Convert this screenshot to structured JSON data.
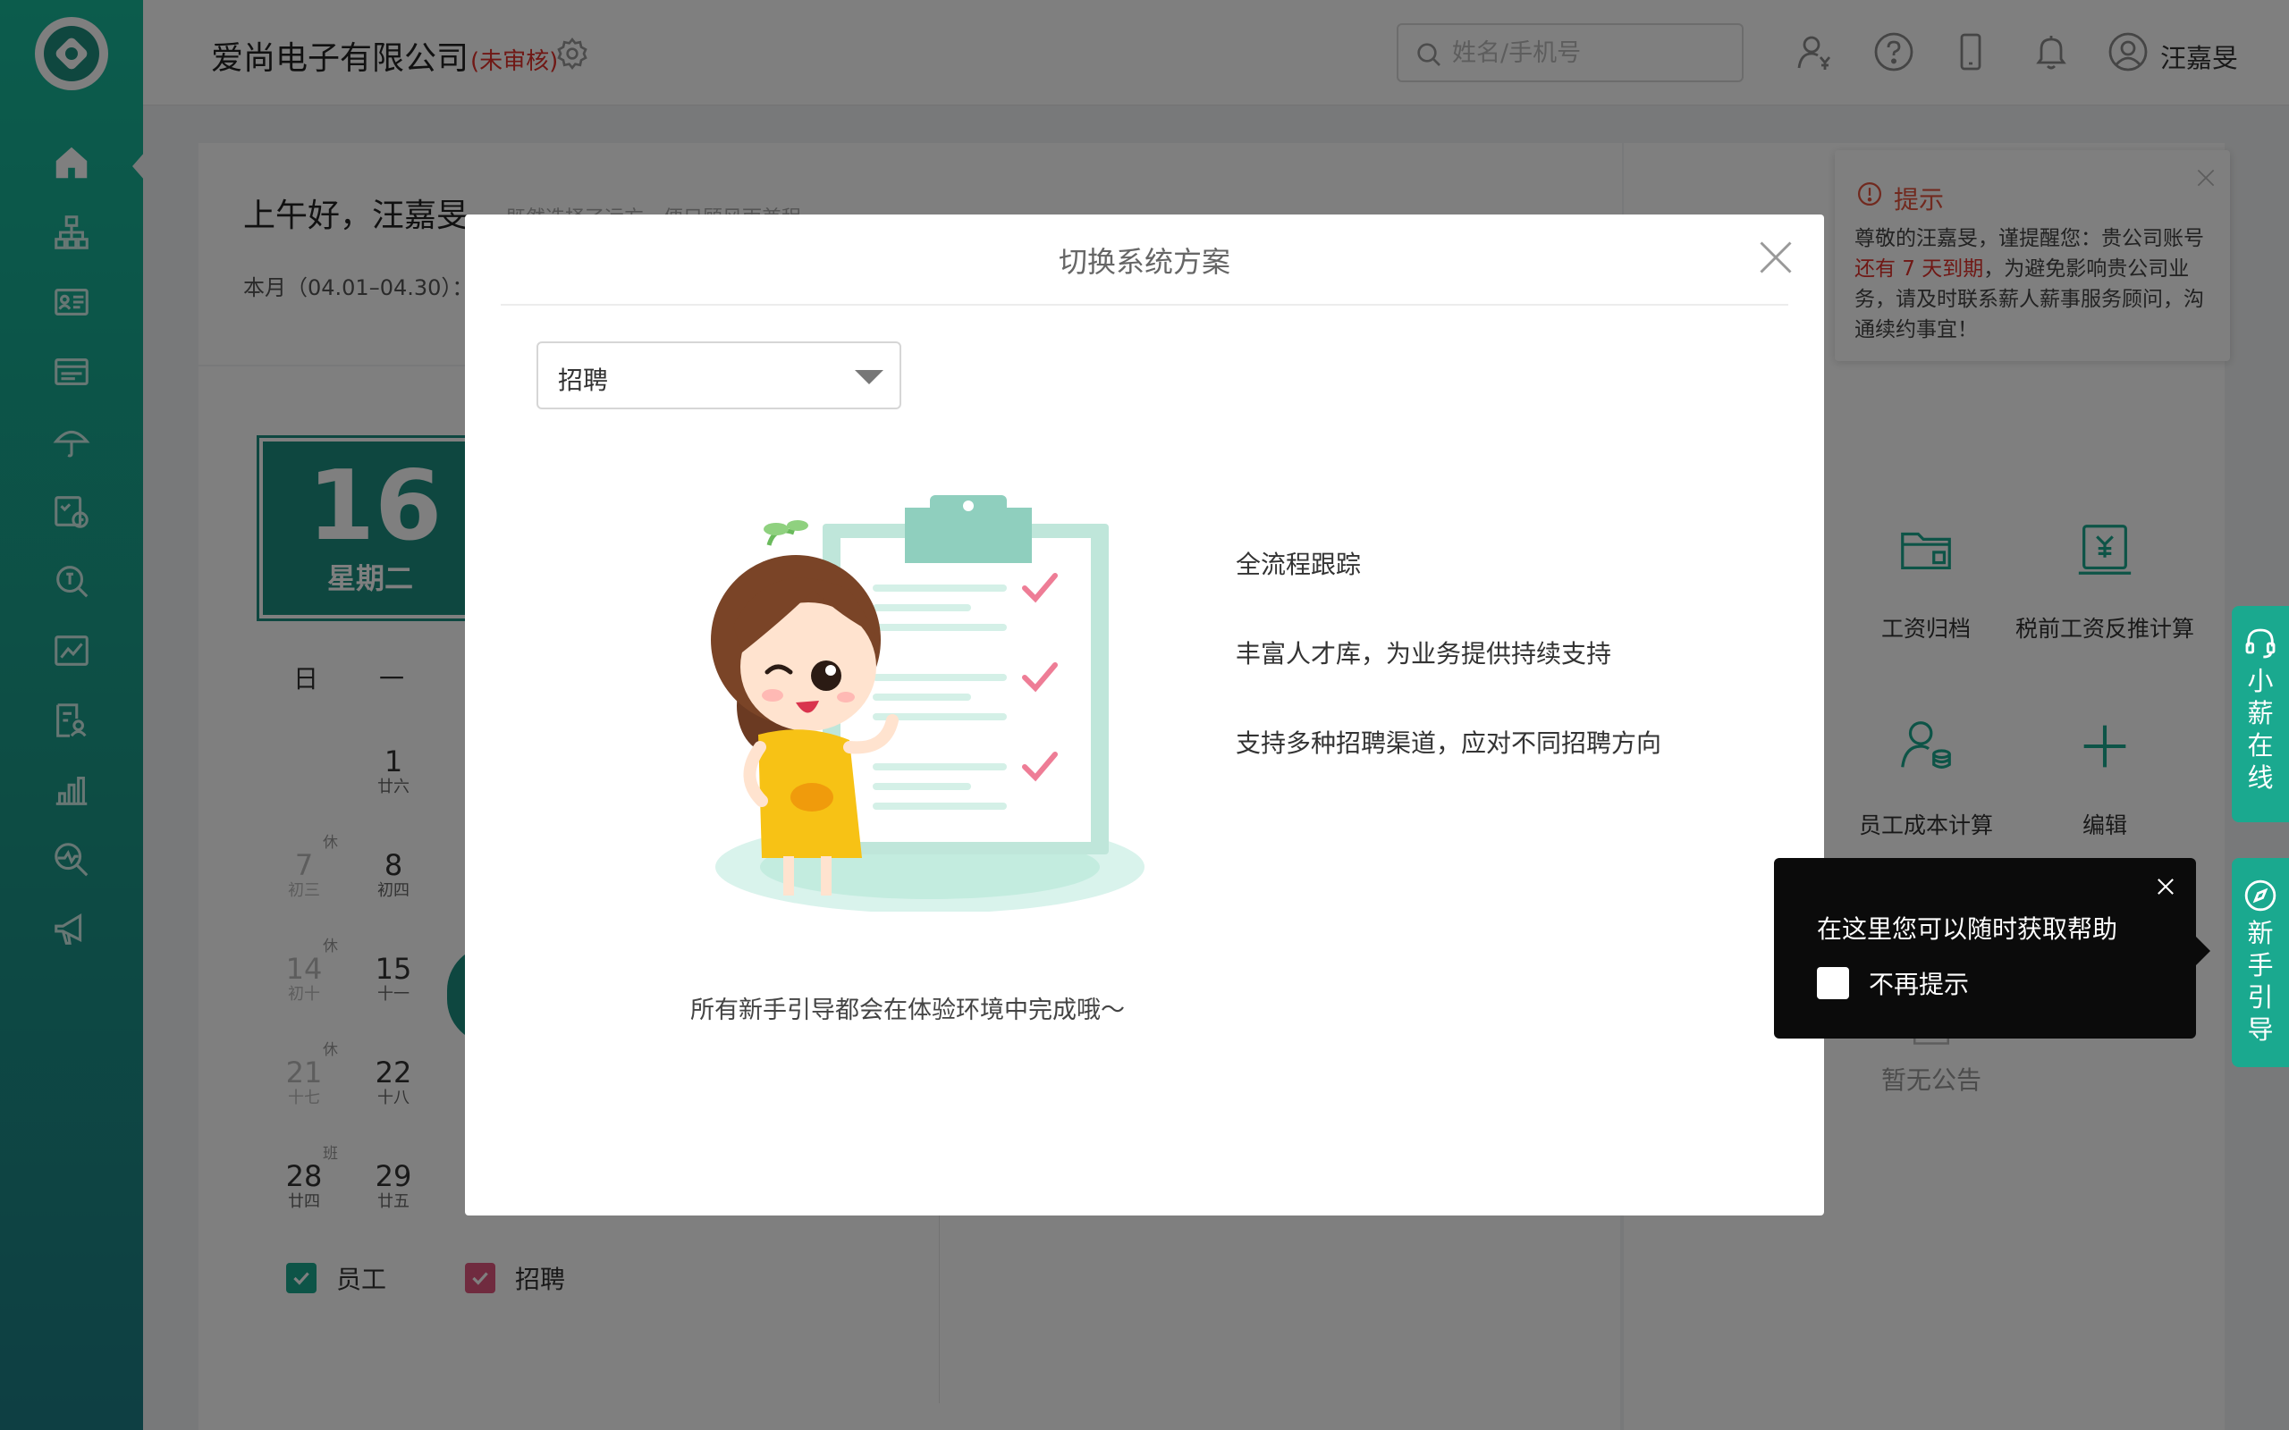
{
  "header": {
    "company": "爱尚电子有限公司",
    "company_status": "(未审核)",
    "search_placeholder": "姓名/手机号",
    "user_name": "汪嘉旻"
  },
  "dashboard": {
    "greeting": "上午好，汪嘉旻",
    "greeting_sub": "既然选择了远方，便只顾风雨兼程",
    "month_range": "本月（04.01–04.30）：",
    "today": {
      "day": "16",
      "weekday": "星期二"
    },
    "week_headers": [
      "日",
      "一"
    ],
    "calendar": [
      {
        "d": "1",
        "l": "廿六",
        "mark": ""
      },
      {
        "d": "7",
        "l": "初三",
        "mark": "休",
        "grey": true
      },
      {
        "d": "8",
        "l": "初四",
        "mark": ""
      },
      {
        "d": "14",
        "l": "初十",
        "mark": "休",
        "grey": true
      },
      {
        "d": "15",
        "l": "十一",
        "mark": ""
      },
      {
        "d": "21",
        "l": "十七",
        "mark": "休",
        "grey": true
      },
      {
        "d": "22",
        "l": "十八",
        "mark": ""
      },
      {
        "d": "28",
        "l": "廿四",
        "mark": "班"
      },
      {
        "d": "29",
        "l": "廿五",
        "mark": ""
      }
    ],
    "legend": [
      {
        "label": "员工",
        "color": "#1ba88f"
      },
      {
        "label": "招聘",
        "color": "#e0577e"
      }
    ],
    "quick_actions": [
      {
        "label": "工资归档",
        "icon": "folder-icon"
      },
      {
        "label": "税前工资反推计算",
        "icon": "tax-calc-icon"
      },
      {
        "label": "员工成本计算",
        "icon": "employee-cost-icon"
      },
      {
        "label": "编辑",
        "icon": "plus-icon"
      }
    ],
    "notice_empty": "暂无公告"
  },
  "alert": {
    "title": "提示",
    "body_before": "尊敬的汪嘉旻，谨提醒您：贵公司账号 ",
    "body_highlight": "还有 7 天到期",
    "body_after": "，为避免影响贵公司业务，请及时联系薪人薪事服务顾问，沟通续约事宜！"
  },
  "modal": {
    "title": "切换系统方案",
    "selected": "招聘",
    "features": [
      "全流程跟踪",
      "丰富人才库，为业务提供持续支持",
      "支持多种招聘渠道，应对不同招聘方向"
    ],
    "caption": "所有新手引导都会在体验环境中完成哦～"
  },
  "tooltip": {
    "text": "在这里您可以随时获取帮助",
    "checkbox_label": "不再提示"
  },
  "side_tabs": [
    {
      "label": "小薪在线",
      "icon": "headset-icon"
    },
    {
      "label": "新手引导",
      "icon": "compass-icon"
    }
  ],
  "colors": {
    "brand": "#1aa98f",
    "alert": "#e0302a",
    "recruit": "#e0577e"
  }
}
